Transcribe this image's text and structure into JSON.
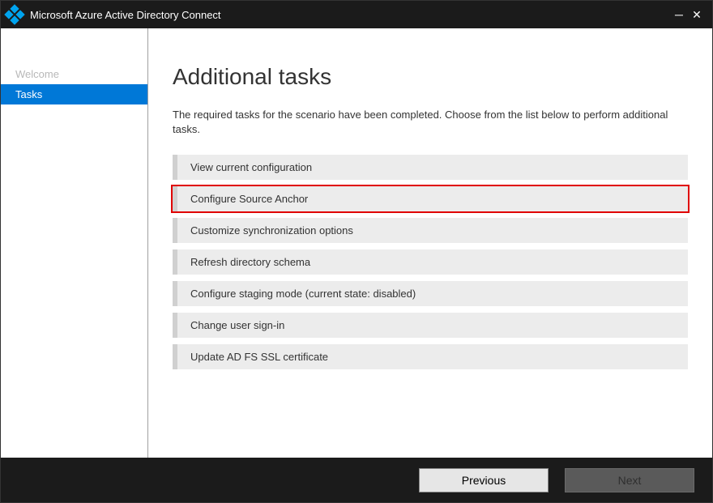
{
  "window": {
    "title": "Microsoft Azure Active Directory Connect"
  },
  "sidebar": {
    "items": [
      {
        "label": "Welcome",
        "active": false
      },
      {
        "label": "Tasks",
        "active": true
      }
    ]
  },
  "main": {
    "heading": "Additional tasks",
    "description": "The required tasks for the scenario have been completed. Choose from the list below to perform additional tasks.",
    "tasks": [
      {
        "label": "View current configuration"
      },
      {
        "label": "Configure Source Anchor",
        "highlighted": true
      },
      {
        "label": "Customize synchronization options"
      },
      {
        "label": "Refresh directory schema"
      },
      {
        "label": "Configure staging mode (current state: disabled)"
      },
      {
        "label": "Change user sign-in"
      },
      {
        "label": "Update AD FS SSL certificate"
      }
    ]
  },
  "footer": {
    "previous_label": "Previous",
    "next_label": "Next",
    "next_enabled": false
  }
}
